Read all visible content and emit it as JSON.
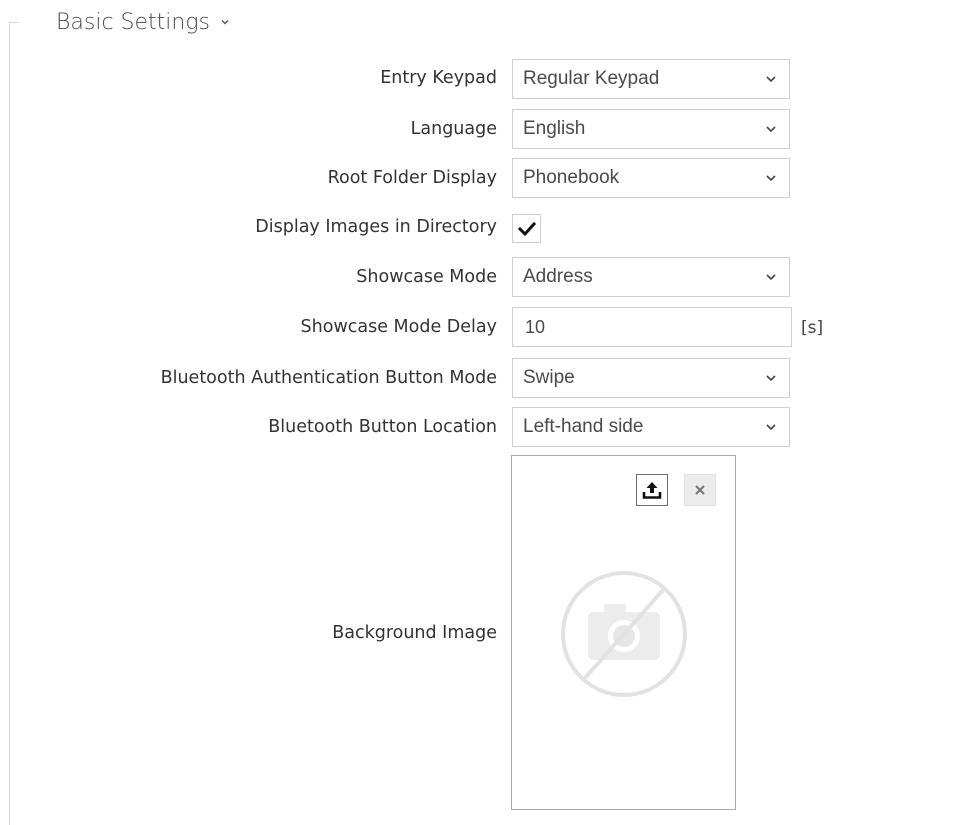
{
  "section": {
    "title": "Basic Settings"
  },
  "fields": {
    "entry_keypad": {
      "label": "Entry Keypad",
      "value": "Regular Keypad"
    },
    "language": {
      "label": "Language",
      "value": "English"
    },
    "root_folder_display": {
      "label": "Root Folder Display",
      "value": "Phonebook"
    },
    "display_images": {
      "label": "Display Images in Directory",
      "checked": true
    },
    "showcase_mode": {
      "label": "Showcase Mode",
      "value": "Address"
    },
    "showcase_mode_delay": {
      "label": "Showcase Mode Delay",
      "value": "10",
      "unit": "[s]"
    },
    "bt_auth_button_mode": {
      "label": "Bluetooth Authentication Button Mode",
      "value": "Swipe"
    },
    "bt_button_location": {
      "label": "Bluetooth Button Location",
      "value": "Left-hand side"
    },
    "background_image": {
      "label": "Background Image"
    }
  },
  "icons": {
    "section_toggle": "chevron-down-icon",
    "dropdown": "chevron-down-icon",
    "checkbox": "checkmark-icon",
    "upload": "upload-icon",
    "remove": "close-icon",
    "placeholder": "no-image-icon"
  },
  "colors": {
    "border": "#cfcfcf",
    "text": "#333333",
    "placeholder": "#e6e6e6"
  }
}
